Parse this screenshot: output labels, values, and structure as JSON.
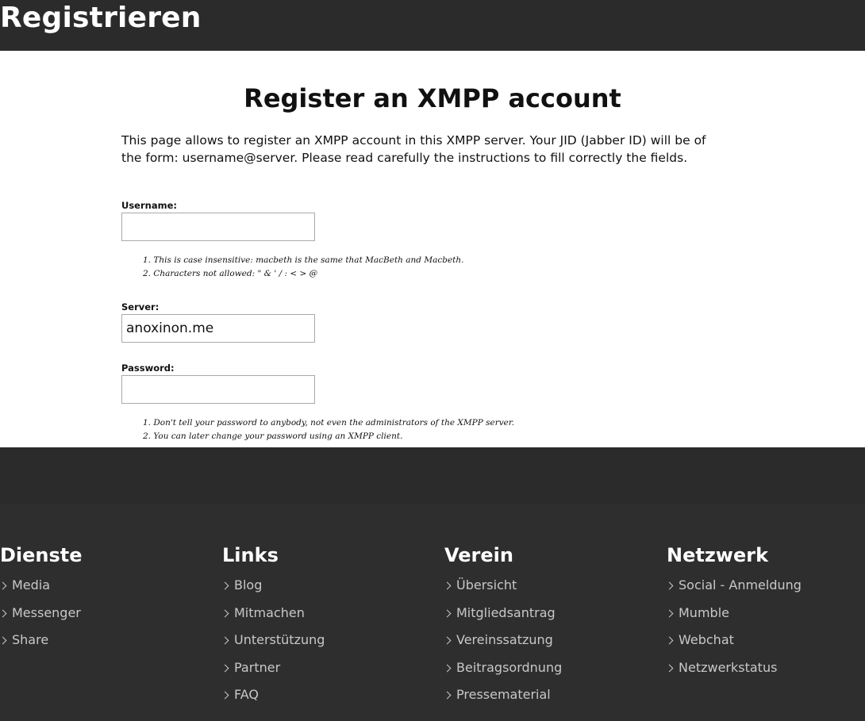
{
  "header": {
    "title": "Registrieren"
  },
  "form": {
    "heading": "Register an XMPP account",
    "intro": "This page allows to register an XMPP account in this XMPP server. Your JID (Jabber ID) will be of the form: username@server. Please read carefully the instructions to fill correctly the fields.",
    "username": {
      "label": "Username:",
      "value": "",
      "notes": [
        "1. This is case insensitive: macbeth is the same that MacBeth and Macbeth.",
        "2. Characters not allowed: \" & ' / : < > @"
      ]
    },
    "server": {
      "label": "Server:",
      "value": "anoxinon.me"
    },
    "password": {
      "label": "Password:",
      "value": "",
      "notes": [
        "1. Don't tell your password to anybody, not even the administrators of the XMPP server.",
        "2. You can later change your password using an XMPP client."
      ]
    }
  },
  "footer": {
    "columns": [
      {
        "title": "Dienste",
        "items": [
          "Media",
          "Messenger",
          "Share"
        ]
      },
      {
        "title": "Links",
        "items": [
          "Blog",
          "Mitmachen",
          "Unterstützung",
          "Partner",
          "FAQ"
        ]
      },
      {
        "title": "Verein",
        "items": [
          "Übersicht",
          "Mitgliedsantrag",
          "Vereinssatzung",
          "Beitragsordnung",
          "Pressematerial"
        ]
      },
      {
        "title": "Netzwerk",
        "items": [
          "Social - Anmeldung",
          "Mumble",
          "Webchat",
          "Netzwerkstatus"
        ]
      }
    ]
  },
  "colors": {
    "header_bg": "#2b2b2b",
    "footer_bg": "#2e2e2e",
    "footer_link": "#c8c8c8"
  }
}
